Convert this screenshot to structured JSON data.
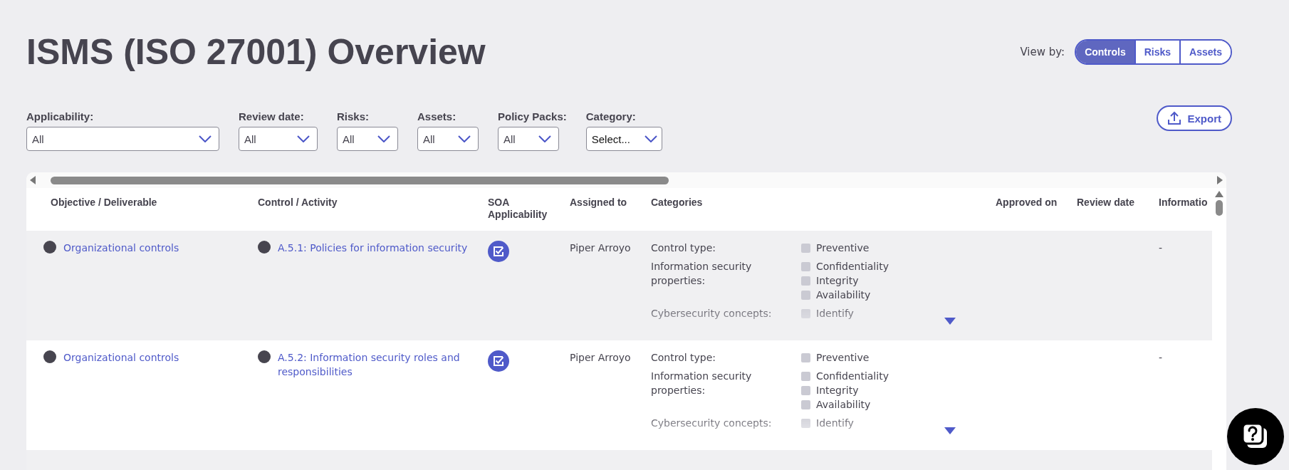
{
  "page": {
    "title": "ISMS (ISO 27001) Overview"
  },
  "view_by": {
    "label": "View by:",
    "options": [
      {
        "label": "Controls",
        "selected": true
      },
      {
        "label": "Risks",
        "selected": false
      },
      {
        "label": "Assets",
        "selected": false
      }
    ]
  },
  "filters": [
    {
      "label": "Applicability:",
      "value": "All"
    },
    {
      "label": "Review date:",
      "value": "All"
    },
    {
      "label": "Risks:",
      "value": "All"
    },
    {
      "label": "Assets:",
      "value": "All"
    },
    {
      "label": "Policy Packs:",
      "value": "All"
    },
    {
      "label": "Category:",
      "value": "Select..."
    }
  ],
  "export_button": {
    "label": "Export"
  },
  "table": {
    "columns": [
      "Objective / Deliverable",
      "Control / Activity",
      "SOA Applicability",
      "Assigned to",
      "Categories",
      "Approved on",
      "Review date",
      "Informatio"
    ],
    "rows": [
      {
        "objective": "Organizational controls",
        "control": "A.5.1: Policies for information security",
        "soa_applicable": true,
        "assigned_to": "Piper Arroyo",
        "expanded": false,
        "information": "-",
        "categories": [
          {
            "label": "Control type:",
            "values": [
              {
                "label": "Preventive",
                "checked": false
              }
            ]
          },
          {
            "label": "Information security properties:",
            "values": [
              {
                "label": "Confidentiality",
                "checked": false
              },
              {
                "label": "Integrity",
                "checked": false
              },
              {
                "label": "Availability",
                "checked": false
              }
            ]
          },
          {
            "label": "Cybersecurity concepts:",
            "values": [
              {
                "label": "Identify",
                "checked": false
              }
            ]
          }
        ]
      },
      {
        "objective": "Organizational controls",
        "control": "A.5.2: Information security roles and responsibilities",
        "soa_applicable": true,
        "assigned_to": "Piper Arroyo",
        "expanded": false,
        "information": "-",
        "categories": [
          {
            "label": "Control type:",
            "values": [
              {
                "label": "Preventive",
                "checked": false
              }
            ]
          },
          {
            "label": "Information security properties:",
            "values": [
              {
                "label": "Confidentiality",
                "checked": false
              },
              {
                "label": "Integrity",
                "checked": false
              },
              {
                "label": "Availability",
                "checked": false
              }
            ]
          },
          {
            "label": "Cybersecurity concepts:",
            "values": [
              {
                "label": "Identify",
                "checked": false
              }
            ]
          }
        ]
      }
    ]
  }
}
